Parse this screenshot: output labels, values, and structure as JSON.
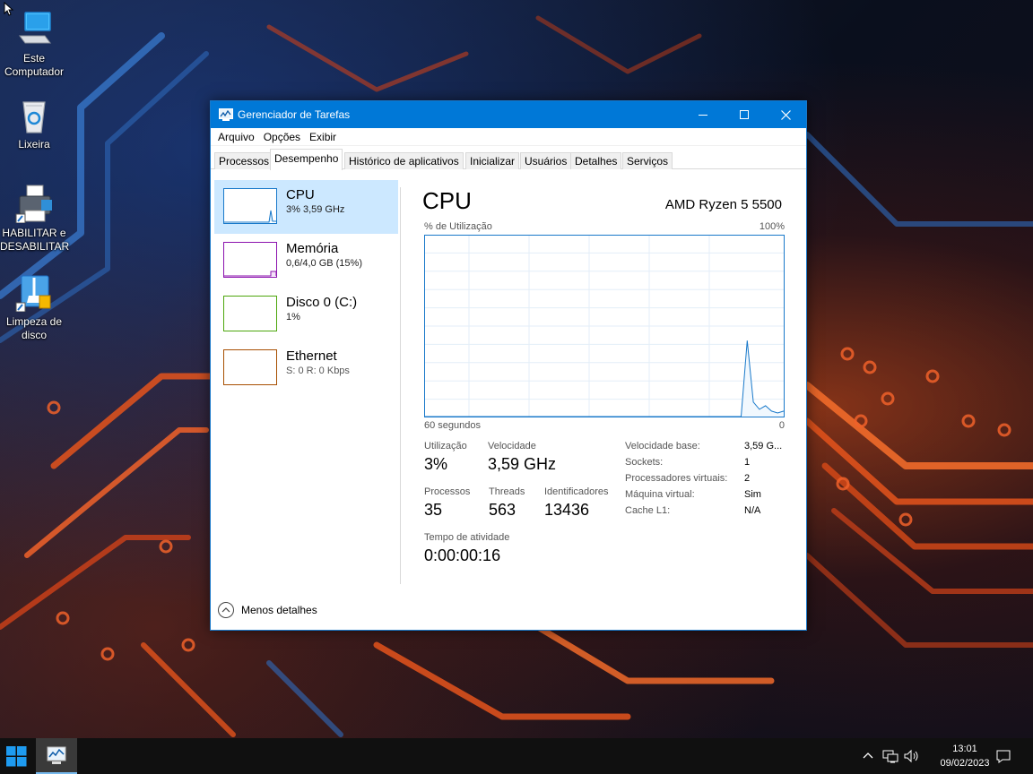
{
  "desktop": {
    "icons": [
      {
        "label": "Este Computador",
        "icon": "computer-icon"
      },
      {
        "label": "Lixeira",
        "icon": "recycle-bin-icon"
      },
      {
        "label": "HABILITAR e DESABILITAR",
        "icon": "printer-shortcut-icon"
      },
      {
        "label": "Limpeza de disco",
        "icon": "disk-cleanup-icon"
      }
    ]
  },
  "window": {
    "title": "Gerenciador de Tarefas",
    "buttons": {
      "minimize": "—",
      "maximize": "☐",
      "close": "✕"
    },
    "menu": [
      "Arquivo",
      "Opções",
      "Exibir"
    ],
    "tabs": [
      "Processos",
      "Desempenho",
      "Histórico de aplicativos",
      "Inicializar",
      "Usuários",
      "Detalhes",
      "Serviços"
    ],
    "active_tab": "Desempenho"
  },
  "perf_list": [
    {
      "name": "CPU",
      "sub": "3% 3,59 GHz",
      "color": "#1979ca",
      "selected": true
    },
    {
      "name": "Memória",
      "sub": "0,6/4,0 GB (15%)",
      "color": "#8b12ae"
    },
    {
      "name": "Disco 0 (C:)",
      "sub": "1%",
      "color": "#4da60c"
    },
    {
      "name": "Ethernet",
      "sub": "S: 0  R: 0 Kbps",
      "color": "#a74f01"
    }
  ],
  "cpu": {
    "header": "CPU",
    "model": "AMD Ryzen 5 5500",
    "util_label": "% de Utilização",
    "util_max": "100%",
    "graph_left": "60 segundos",
    "graph_right": "0",
    "graph_color": "#1979ca",
    "graph_samples": [
      0,
      0,
      0,
      0,
      0,
      0,
      0,
      0,
      0,
      0,
      0,
      0,
      0,
      0,
      0,
      0,
      0,
      0,
      0,
      0,
      0,
      0,
      0,
      0,
      0,
      0,
      0,
      0,
      0,
      0,
      0,
      0,
      0,
      0,
      0,
      0,
      0,
      0,
      0,
      0,
      0,
      0,
      0,
      0,
      0,
      0,
      0,
      0,
      0,
      0,
      0,
      0,
      0,
      42,
      8,
      4,
      6,
      3,
      2,
      3
    ],
    "stats": {
      "utilizacao": {
        "label": "Utilização",
        "value": "3%"
      },
      "velocidade": {
        "label": "Velocidade",
        "value": "3,59 GHz"
      },
      "processos": {
        "label": "Processos",
        "value": "35"
      },
      "threads": {
        "label": "Threads",
        "value": "563"
      },
      "identificadores": {
        "label": "Identificadores",
        "value": "13436"
      },
      "tempo": {
        "label": "Tempo de atividade",
        "value": "0:00:00:16"
      }
    },
    "details": [
      {
        "k": "Velocidade base:",
        "v": "3,59 G..."
      },
      {
        "k": "Sockets:",
        "v": "1"
      },
      {
        "k": "Processadores virtuais:",
        "v": "2"
      },
      {
        "k": "Máquina virtual:",
        "v": "Sim"
      },
      {
        "k": "Cache L1:",
        "v": "N/A"
      }
    ]
  },
  "footer": {
    "fewer_details": "Menos detalhes"
  },
  "taskbar": {
    "time": "13:01",
    "date": "09/02/2023",
    "tray_icons": [
      "chevron-up-icon",
      "network-icon",
      "volume-icon",
      "notification-icon"
    ]
  }
}
